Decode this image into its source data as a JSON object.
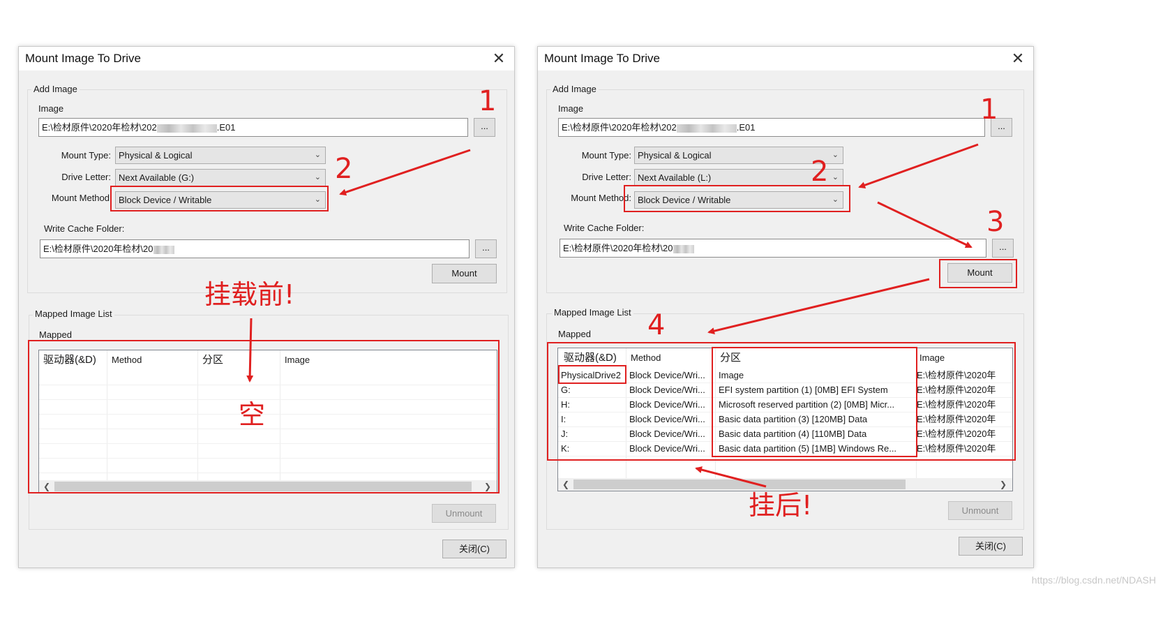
{
  "dialog_title": "Mount Image To Drive",
  "close_glyph": "✕",
  "add_image_label": "Add Image",
  "image_label": "Image",
  "image_path_prefix": "E:\\检材原件\\2020年检材\\202",
  "image_path_suffix": ".E01",
  "browse_label": "...",
  "mount_type_label": "Mount Type:",
  "mount_type_value": "Physical & Logical",
  "drive_letter_label": "Drive Letter:",
  "mount_method_label": "Mount Method",
  "mount_method_label_colon": "Mount Method:",
  "mount_method_value": "Block Device / Writable",
  "write_cache_label": "Write Cache Folder:",
  "write_cache_prefix": "E:\\检材原件\\2020年检材\\20",
  "mount_button": "Mount",
  "mapped_image_list_label": "Mapped Image List",
  "mapped_label": "Mapped",
  "columns": [
    "驱动器(&D)",
    "Method",
    "分区",
    "Image"
  ],
  "unmount_button": "Unmount",
  "close_button": "关闭(C)",
  "left": {
    "drive_letter_value": "Next Available (G:)",
    "rows": []
  },
  "right": {
    "drive_letter_value": "Next Available (L:)",
    "rows": [
      {
        "drive": "PhysicalDrive2",
        "method": "Block Device/Wri...",
        "partition": "Image",
        "image": "E:\\检材原件\\2020年"
      },
      {
        "drive": "G:",
        "method": "Block Device/Wri...",
        "partition": "EFI system partition (1) [0MB] EFI System",
        "image": "E:\\检材原件\\2020年"
      },
      {
        "drive": "H:",
        "method": "Block Device/Wri...",
        "partition": "Microsoft reserved partition (2) [0MB] Micr...",
        "image": "E:\\检材原件\\2020年"
      },
      {
        "drive": "I:",
        "method": "Block Device/Wri...",
        "partition": "Basic data partition (3) [120MB] Data",
        "image": "E:\\检材原件\\2020年"
      },
      {
        "drive": "J:",
        "method": "Block Device/Wri...",
        "partition": "Basic data partition (4) [110MB] Data",
        "image": "E:\\检材原件\\2020年"
      },
      {
        "drive": "K:",
        "method": "Block Device/Wri...",
        "partition": "Basic data partition (5) [1MB] Windows Re...",
        "image": "E:\\检材原件\\2020年"
      }
    ]
  },
  "annotations": {
    "step1": "1",
    "step2": "2",
    "step3": "3",
    "step4": "4",
    "before_mount": "挂载前!",
    "empty": "空",
    "after_mount": "挂后!"
  },
  "annotation_color": "#e02020",
  "watermark": "https://blog.csdn.net/NDASH"
}
